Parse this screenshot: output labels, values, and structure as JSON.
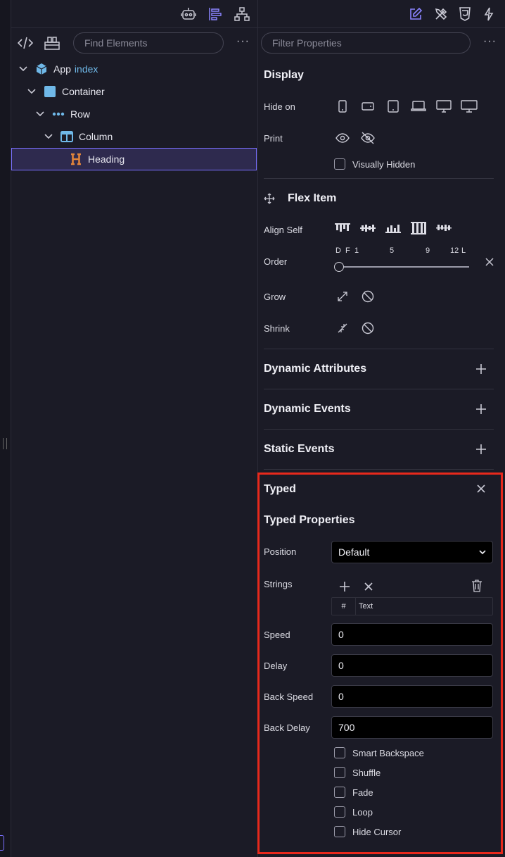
{
  "left_panel": {
    "search": {
      "placeholder": "Find Elements"
    },
    "more_label": "···",
    "tree": [
      {
        "label": "App",
        "suffix": "index",
        "icon": "cube-icon"
      },
      {
        "label": "Container",
        "icon": "container-icon"
      },
      {
        "label": "Row",
        "icon": "row-dots-icon"
      },
      {
        "label": "Column",
        "icon": "column-icon"
      },
      {
        "label": "Heading",
        "icon": "heading-icon",
        "selected": true
      }
    ]
  },
  "right_panel": {
    "filter": {
      "placeholder": "Filter Properties"
    },
    "more_label": "···",
    "display": {
      "title": "Display",
      "hide_on_label": "Hide on",
      "print_label": "Print",
      "visually_hidden_label": "Visually Hidden"
    },
    "flex_item": {
      "title": "Flex Item",
      "align_self_label": "Align Self",
      "order_label": "Order",
      "order_ticks": [
        "D",
        "F",
        "1",
        "5",
        "9",
        "12",
        "L"
      ],
      "grow_label": "Grow",
      "shrink_label": "Shrink"
    },
    "dynamic_attributes": {
      "title": "Dynamic Attributes"
    },
    "dynamic_events": {
      "title": "Dynamic Events"
    },
    "static_events": {
      "title": "Static Events"
    },
    "typed": {
      "title": "Typed",
      "subtitle": "Typed Properties",
      "position_label": "Position",
      "position_value": "Default",
      "strings_label": "Strings",
      "table_hash": "#",
      "table_text": "Text",
      "speed_label": "Speed",
      "speed_value": "0",
      "delay_label": "Delay",
      "delay_value": "0",
      "back_speed_label": "Back Speed",
      "back_speed_value": "0",
      "back_delay_label": "Back Delay",
      "back_delay_value": "700",
      "checkboxes": [
        "Smart Backspace",
        "Shuffle",
        "Fade",
        "Loop",
        "Hide Cursor"
      ]
    }
  },
  "colors": {
    "accent": "#7a70ff",
    "highlight": "#e8291c",
    "heading_icon": "#e0843a",
    "node_icon": "#6fb8e8"
  }
}
